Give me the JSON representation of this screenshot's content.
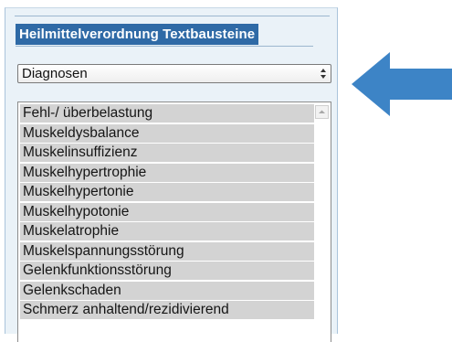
{
  "panel": {
    "title": "Heilmittelverordnung Textbausteine"
  },
  "dropdown": {
    "selected": "Diagnosen",
    "arrows_icon": "updown-chevron-icon"
  },
  "list": {
    "items": [
      "Fehl-/ überbelastung",
      "Muskeldysbalance",
      "Muskelinsuffizienz",
      "Muskelhypertrophie",
      "Muskelhypertonie",
      "Muskelhypotonie",
      "Muskelatrophie",
      "Muskelspannungsstörung",
      "Gelenkfunktionsstörung",
      "Gelenkschaden",
      "Schmerz anhaltend/rezidivierend"
    ],
    "scroll_icon": "scroll-up-icon"
  },
  "annotation": {
    "icon": "left-arrow-icon",
    "color": "#3d84c6"
  },
  "colors": {
    "title_bg": "#2f6aa6",
    "panel_bg": "#eaf2f8",
    "item_bg": "#d3d3d3"
  }
}
